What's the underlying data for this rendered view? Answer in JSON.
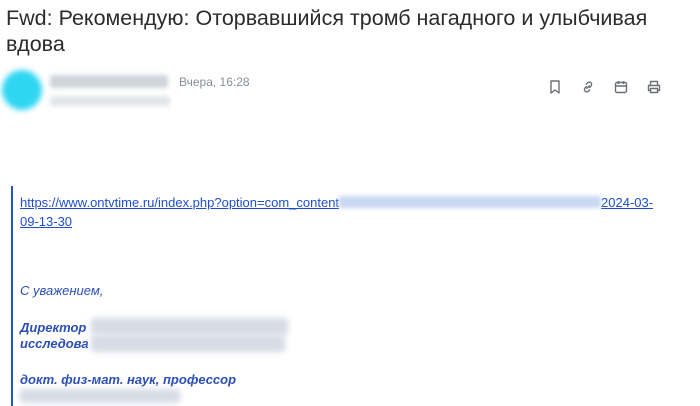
{
  "message": {
    "subject": "Fwd: Рекомендую: Оторвавшийся тромб нагадного и улыбчивая вдова",
    "date": "Вчера, 16:28"
  },
  "toolbar": {
    "icons": [
      "bookmark-icon",
      "link-icon",
      "calendar-icon",
      "print-icon"
    ]
  },
  "body": {
    "link_start": "https://www.ontvtime.ru/index.php?option=com_content",
    "link_end": "2024-03-",
    "link_wrap": "09-13-30",
    "greeting": "С уважением,",
    "title_line1": "Директор",
    "title_line2": "исследова",
    "degree": "докт. физ-мат. наук, профессор"
  },
  "colors": {
    "link": "#1f4fcf",
    "signature": "#2b4fb5",
    "quote_bar": "#2154c4",
    "avatar": "#2fd6f2"
  }
}
